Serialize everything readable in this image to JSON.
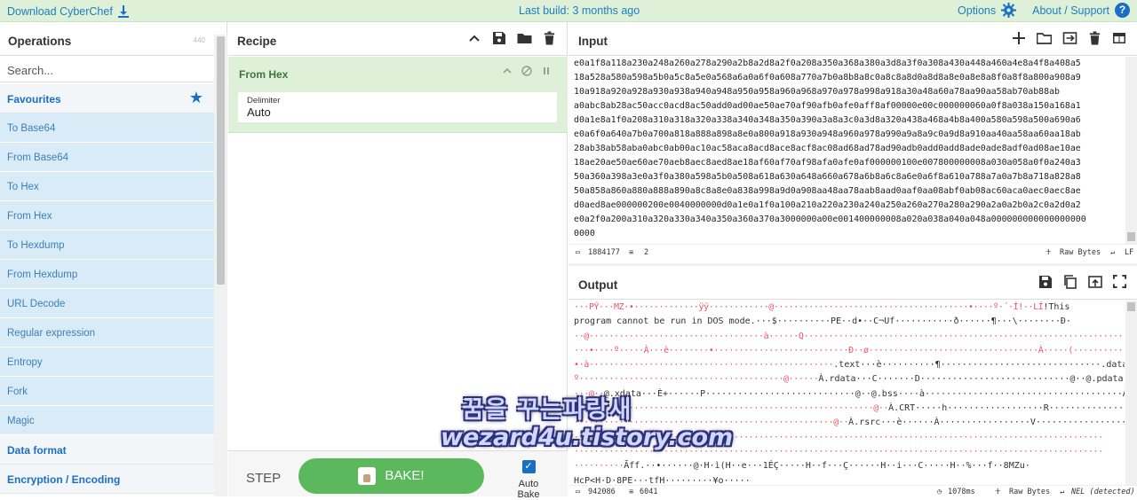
{
  "banner": {
    "download": "Download CyberChef",
    "build": "Last build: 3 months ago",
    "options": "Options",
    "about": "About / Support",
    "help_glyph": "?"
  },
  "operations": {
    "title": "Operations",
    "count": "440",
    "search_placeholder": "Search...",
    "items": [
      {
        "label": "Favourites",
        "kind": "category"
      },
      {
        "label": "To Base64",
        "kind": "op"
      },
      {
        "label": "From Base64",
        "kind": "op"
      },
      {
        "label": "To Hex",
        "kind": "op"
      },
      {
        "label": "From Hex",
        "kind": "op"
      },
      {
        "label": "To Hexdump",
        "kind": "op"
      },
      {
        "label": "From Hexdump",
        "kind": "op"
      },
      {
        "label": "URL Decode",
        "kind": "op"
      },
      {
        "label": "Regular expression",
        "kind": "op"
      },
      {
        "label": "Entropy",
        "kind": "op"
      },
      {
        "label": "Fork",
        "kind": "op"
      },
      {
        "label": "Magic",
        "kind": "op"
      },
      {
        "label": "Data format",
        "kind": "category"
      },
      {
        "label": "Encryption / Encoding",
        "kind": "category"
      }
    ]
  },
  "recipe": {
    "title": "Recipe",
    "operation_name": "From Hex",
    "delimiter_label": "Delimiter",
    "delimiter_value": "Auto",
    "step_label": "STEP",
    "bake_label": "BAKE!",
    "auto_bake_label": "Auto Bake",
    "auto_bake_checked": true
  },
  "input": {
    "title": "Input",
    "lines": [
      "e0a1f8a118a230a248a260a278a290a2b8a2d8a2f0a208a350a368a380a3d8a3f0a308a430a448a460a4e8a4f8a408a5",
      "18a528a580a598a5b0a5c8a5e0a568a6a0a6f0a608a770a7b0a8b8a8c0a8c8a8d0a8d8a8e0a8e8a8f0a8f8a800a908a9",
      "10a918a920a928a930a938a940a948a950a958a960a968a970a978a998a918a30a48a60a78aa90aa58ab70ab88ab",
      "a0abc8ab28ac50acc0acd8ac50add0ad00ae50ae70af90afb0afe0aff8af00000e00c000000060a0f8a038a150a168a1",
      "d0a1e8a1f0a208a310a318a320a338a340a348a350a390a3a8a3c0a3d8a320a438a468a4b8a400a580a598a500a690a6",
      "e0a6f0a640a7b0a700a818a888a898a8e0a800a918a930a948a960a978a990a9a8a9c0a9d8a910aa40aa58aa60aa18ab",
      "28ab38ab58aba0abc0ab00ac10ac58aca8acd8ace8acf8ac08ad68ad78ad90adb0add0add8ade0ade8adf0ad08ae10ae",
      "18ae20ae50ae60ae70aeb8aec8aed8ae18af60af70af98afa0afe0af000000100e007800000008a030a058a0f0a240a3",
      "50a360a398a3e0a3f0a380a598a5b0a508a618a630a648a660a678a6b8a6c8a6e0a6f8a610a788a7a0a7b8a718a828a8",
      "50a858a860a880a888a890a8c8a8e0a838a998a9d0a908aa48aa78aab8aad0aaf0aa08abf0ab08ac60aca0aec0aec8ae",
      "d0aed8ae000000200e0040000000d0a1e0a1f0a100a210a220a230a240a250a260a270a280a290a2a0a2b0a2c0a2d0a2",
      "e0a2f0a200a310a320a330a340a350a360a370a3000000a00e001400000008a020a038a040a048a000000000000000000",
      "0000"
    ],
    "length": "1884177",
    "lines_count": "2",
    "encoding": "Raw Bytes",
    "eol": "LF"
  },
  "output": {
    "title": "Output",
    "lines": [
      {
        "noise": "···PÝ···MZ·•·············ÿÿ············@·······································•····º·´·Í!··LÍ",
        "text": "!This"
      },
      {
        "noise": "",
        "text": "program cannot be run in DOS mode.···$··········PE··d•··C¬Uf···········ð······¶···\\········Ð·"
      },
      {
        "noise": "··@···································à······Q···································································",
        "text": ""
      },
      {
        "noise": "···•····º·····À···è········•···························Ð··ø··································À·····(················X",
        "text": ""
      },
      {
        "noise": "•·à·················································",
        "text": ".text···è··········¶······························.data···à······Ð"
      },
      {
        "noise": "º·········································@······",
        "text": "À.rdata···C·······D····························@··@.pdata·····················"
      },
      {
        "noise": "···@··",
        "text": "@.xdata···È+······P····························@··@.bss····à·····································À.idata"
      },
      {
        "noise": "····························································@··",
        "text": "À.CRT·····h··················R····················@··À.tls···················°"
      },
      {
        "noise": "····················································@··",
        "text": "À.rsrc···è······À·················V·····················@··@.reloc···ø···Ð···········\\"
      },
      {
        "noise": "··········································································································",
        "text": ""
      },
      {
        "noise": "··········································································································",
        "text": ""
      },
      {
        "noise": "··········",
        "text": "Ãff.··•······@·H·ì(H··e···1ÉÇ·····H··f···Ç······H··i···C·····H··%···f··8MZu·"
      },
      {
        "noise": "",
        "text": "HcP<H·D·8PE···tfH·········¥o·····"
      }
    ],
    "length": "942086",
    "lines_count": "6041",
    "time": "1078ms",
    "encoding": "Raw Bytes",
    "eol": "NEL (detected)"
  },
  "watermark": {
    "line1": "꿈을 꾸는파랑새",
    "line2": "wezard4u.tistory.com"
  }
}
